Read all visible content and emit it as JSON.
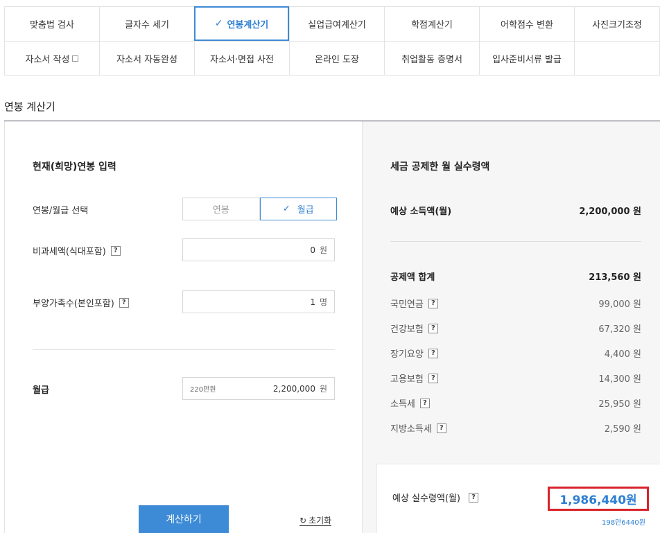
{
  "tools": {
    "row1": [
      "맞춤법 검사",
      "글자수 세기",
      "연봉계산기",
      "실업급여계산기",
      "학점계산기",
      "어학점수 변환",
      "사진크기조정"
    ],
    "row2": [
      "자소서 작성",
      "자소서 자동완성",
      "자소서·면접 사전",
      "온라인 도장",
      "취업활동 증명서",
      "입사준비서류 발급"
    ],
    "active": "연봉계산기"
  },
  "page_title": "연봉 계산기",
  "left": {
    "section_title": "현재(희망)연봉 입력",
    "mode_label": "연봉/월급 선택",
    "mode_options": [
      "연봉",
      "월급"
    ],
    "mode_selected": "월급",
    "nontax_label": "비과세액(식대포함)",
    "nontax_value": "0",
    "nontax_unit": "원",
    "dependents_label": "부양가족수(본인포함)",
    "dependents_value": "1",
    "dependents_unit": "명",
    "salary_label": "월급",
    "salary_hint": "220만원",
    "salary_value": "2,200,000",
    "salary_unit": "원",
    "calc_button": "계산하기",
    "reset_label": "초기화",
    "help_mark": "?"
  },
  "right": {
    "section_title": "세금 공제한 월 실수령액",
    "income_label": "예상 소득액(월)",
    "income_value": "2,200,000 원",
    "deduction_total_label": "공제액 합계",
    "deduction_total_value": "213,560 원",
    "deductions": [
      {
        "label": "국민연금",
        "value": "99,000 원"
      },
      {
        "label": "건강보험",
        "value": "67,320 원"
      },
      {
        "label": "장기요양",
        "value": "4,400 원"
      },
      {
        "label": "고용보험",
        "value": "14,300 원"
      },
      {
        "label": "소득세",
        "value": "25,950 원"
      },
      {
        "label": "지방소득세",
        "value": "2,590 원"
      }
    ],
    "net_label": "예상 실수령액(월)",
    "net_value": "1,986,440원",
    "net_sub": "198만6440원"
  },
  "colors": {
    "accent": "#3d8ad6",
    "highlight_border": "#d9222a"
  }
}
